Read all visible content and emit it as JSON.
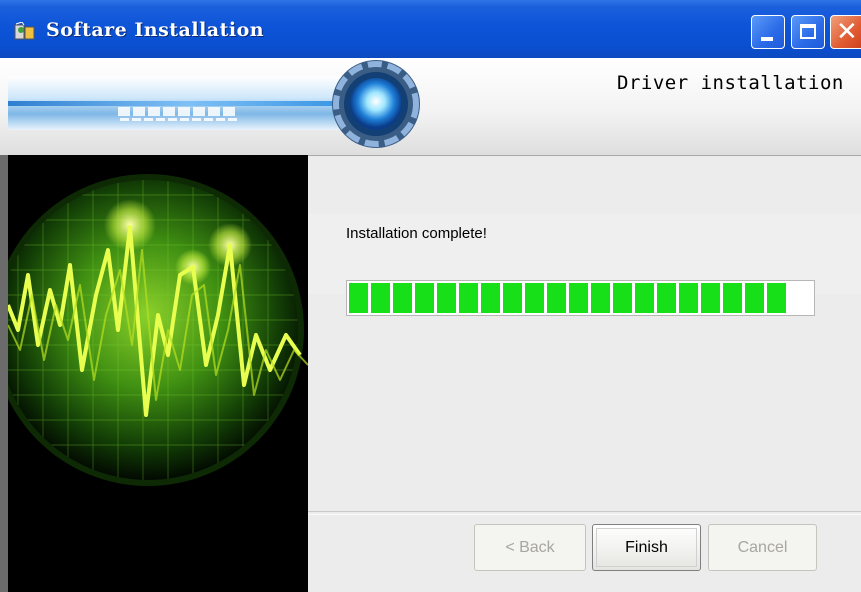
{
  "window": {
    "title": "Softare Installation",
    "controls": {
      "minimize": "minimize",
      "maximize": "maximize",
      "close": "close"
    }
  },
  "header": {
    "title": "Driver installation"
  },
  "main": {
    "status_text": "Installation complete!",
    "progress": {
      "fraction": 1.0,
      "segments": 20,
      "color": "#18e018"
    }
  },
  "buttons": {
    "back_label": "< Back",
    "finish_label": "Finish",
    "cancel_label": "Cancel"
  },
  "colors": {
    "titlebar": "#0d54d8",
    "progress_fill": "#18e018",
    "close_button": "#e05a30"
  }
}
